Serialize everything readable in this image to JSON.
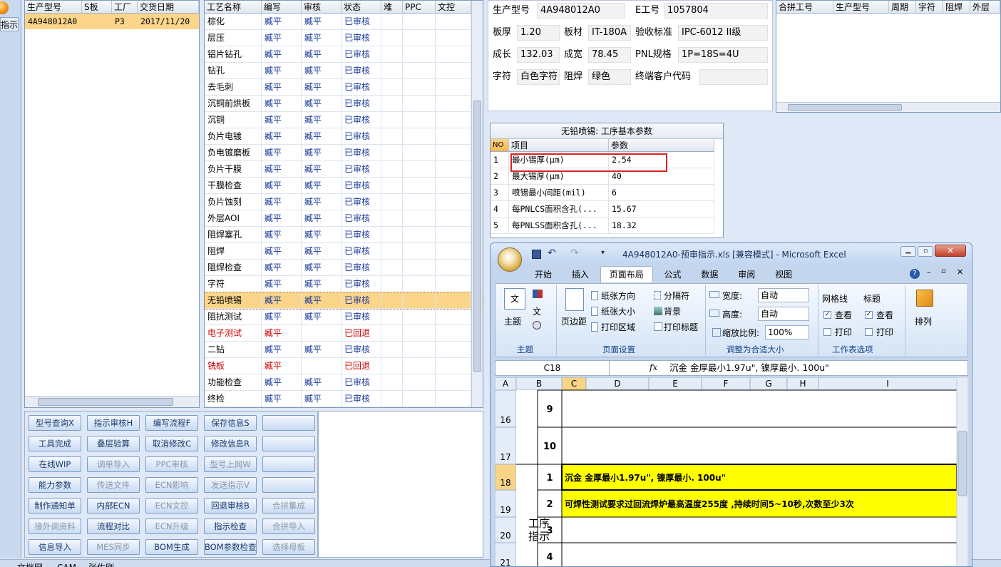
{
  "left_tab": {
    "label": "指示"
  },
  "orders": {
    "columns": [
      "生产型号",
      "S板",
      "工厂",
      "交货日期"
    ],
    "rows": [
      [
        "4A948012A0",
        "",
        "P3",
        "2017/11/20"
      ]
    ]
  },
  "process": {
    "columns": [
      "工艺名称",
      "编写",
      "审核",
      "状态",
      "难",
      "PPC",
      "文控"
    ],
    "rows": [
      {
        "name": "棕化",
        "writer": "臧平",
        "reviewer": "臧平",
        "status": "已审核"
      },
      {
        "name": "层压",
        "writer": "臧平",
        "reviewer": "臧平",
        "status": "已审核"
      },
      {
        "name": "铝片钻孔",
        "writer": "臧平",
        "reviewer": "臧平",
        "status": "已审核"
      },
      {
        "name": "钻孔",
        "writer": "臧平",
        "reviewer": "臧平",
        "status": "已审核"
      },
      {
        "name": "去毛刺",
        "writer": "臧平",
        "reviewer": "臧平",
        "status": "已审核"
      },
      {
        "name": "沉铜前烘板",
        "writer": "臧平",
        "reviewer": "臧平",
        "status": "已审核"
      },
      {
        "name": "沉铜",
        "writer": "臧平",
        "reviewer": "臧平",
        "status": "已审核"
      },
      {
        "name": "负片电镀",
        "writer": "臧平",
        "reviewer": "臧平",
        "status": "已审核"
      },
      {
        "name": "负电镀磨板",
        "writer": "臧平",
        "reviewer": "臧平",
        "status": "已审核"
      },
      {
        "name": "负片干膜",
        "writer": "臧平",
        "reviewer": "臧平",
        "status": "已审核"
      },
      {
        "name": "干膜检查",
        "writer": "臧平",
        "reviewer": "臧平",
        "status": "已审核"
      },
      {
        "name": "负片蚀刻",
        "writer": "臧平",
        "reviewer": "臧平",
        "status": "已审核"
      },
      {
        "name": "外层AOI",
        "writer": "臧平",
        "reviewer": "臧平",
        "status": "已审核"
      },
      {
        "name": "阻焊塞孔",
        "writer": "臧平",
        "reviewer": "臧平",
        "status": "已审核"
      },
      {
        "name": "阻焊",
        "writer": "臧平",
        "reviewer": "臧平",
        "status": "已审核"
      },
      {
        "name": "阻焊检查",
        "writer": "臧平",
        "reviewer": "臧平",
        "status": "已审核"
      },
      {
        "name": "字符",
        "writer": "臧平",
        "reviewer": "臧平",
        "status": "已审核"
      },
      {
        "name": "无铅喷锡",
        "writer": "臧平",
        "reviewer": "臧平",
        "status": "已审核",
        "selected": true
      },
      {
        "name": "阻抗测试",
        "writer": "臧平",
        "reviewer": "臧平",
        "status": "已审核"
      },
      {
        "name": "电子测试",
        "writer": "臧平",
        "reviewer": "",
        "status": "已回退",
        "red": true
      },
      {
        "name": "二钻",
        "writer": "臧平",
        "reviewer": "臧平",
        "status": "已审核"
      },
      {
        "name": "铣板",
        "writer": "臧平",
        "reviewer": "",
        "status": "已回退",
        "red": true
      },
      {
        "name": "功能检查",
        "writer": "臧平",
        "reviewer": "臧平",
        "status": "已审核"
      },
      {
        "name": "终检",
        "writer": "臧平",
        "reviewer": "臧平",
        "status": "已审核"
      }
    ]
  },
  "info": {
    "labels": {
      "model": "生产型号",
      "eno": "E工号",
      "thick": "板厚",
      "material": "板材",
      "standard": "验收标准",
      "len": "成长",
      "width": "成宽",
      "pnl": "PNL规格",
      "char": "字符",
      "mask": "阻焊",
      "client": "终端客户代码"
    },
    "values": {
      "model": "4A948012A0",
      "eno": "1057804",
      "thick": "1.20",
      "material": "IT-180A",
      "standard": "IPC-6012 II级",
      "len": "132.03",
      "width": "78.45",
      "pnl": "1P=18S=4U",
      "char": "白色字符",
      "mask": "绿色",
      "client": ""
    }
  },
  "merge": {
    "columns": [
      "合拼工号",
      "生产型号",
      "周期",
      "字符",
      "阻焊",
      "外层"
    ]
  },
  "params": {
    "title": "无铅喷锡: 工序基本参数",
    "columns": [
      "NO",
      "项目",
      "参数"
    ],
    "rows": [
      [
        "1",
        "最小锡厚(μm)",
        "2.54"
      ],
      [
        "2",
        "最大锡厚(μm)",
        "40"
      ],
      [
        "3",
        "喷锡最小间距(mil)",
        "6"
      ],
      [
        "4",
        "每PNLCS面积含孔(...",
        "15.67"
      ],
      [
        "5",
        "每PNLSS面积含孔(...",
        "18.32"
      ]
    ]
  },
  "buttons": [
    [
      "型号查询X",
      "指示审核H",
      "编写流程F",
      "保存信息S",
      ""
    ],
    [
      "工具完成",
      "叠层验算",
      "取消修改C",
      "修改信息R",
      ""
    ],
    [
      "在线WIP",
      "调单导入",
      "PPC审核",
      "型号上网W",
      ""
    ],
    [
      "能力参数",
      "传送文件",
      "ECN影响",
      "发送指示V",
      ""
    ],
    [
      "制作通知单",
      "内部ECN",
      "ECN文控",
      "回退审核B",
      "合拼集成"
    ],
    [
      "接外调资料",
      "流程对比",
      "ECN升级",
      "指示检查",
      "合拼导入"
    ],
    [
      "信息导入",
      "MES同步",
      "BOM生成",
      "BOM参数检查",
      "选择母板"
    ]
  ],
  "bottom_tabs": [
    "文档网",
    "CAM",
    "张佐刚"
  ],
  "excel": {
    "title": "4A948012A0-预审指示.xls [兼容模式] - Microsoft Excel",
    "tabs": [
      "开始",
      "插入",
      "页面布局",
      "公式",
      "数据",
      "审阅",
      "视图"
    ],
    "ribbon": {
      "theme": "主题",
      "margin": "页边距",
      "orientation": "纸张方向",
      "size": "纸张大小",
      "area": "打印区域",
      "breaks": "分隔符",
      "background": "背景",
      "titles": "打印标题",
      "width_label": "宽度:",
      "width_value": "自动",
      "height_label": "高度:",
      "height_value": "自动",
      "scale_label": "缩放比例:",
      "scale_value": "100%",
      "gridlines": "网格线",
      "headings": "标题",
      "view": "查看",
      "print": "打印",
      "arrange": "排列",
      "group_theme": "主题",
      "group_page": "页面设置",
      "group_fit": "调整为合适大小",
      "group_sheet": "工作表选项"
    },
    "name_box": "C18",
    "formula": "沉金 金厚最小1.97u\", 镍厚最小. 100u\"",
    "columns": [
      "A",
      "B",
      "C",
      "D",
      "E",
      "F",
      "G",
      "H",
      "I"
    ],
    "rows": [
      {
        "num": "16",
        "b": "9",
        "c": ""
      },
      {
        "num": "17",
        "b": "10",
        "c": ""
      },
      {
        "num": "18",
        "b": "1",
        "c": "沉金 金厚最小1.97u\", 镍厚最小. 100u\""
      },
      {
        "num": "19",
        "b": "2",
        "c": "可焊性测试要求过回流焊炉最高温度255度 ,持续时间5~10秒,次数至少3次"
      },
      {
        "num": "20",
        "b": "3",
        "c": ""
      },
      {
        "num": "21",
        "b": "4",
        "c": ""
      }
    ],
    "merged_a": "工序\n指示"
  },
  "colors": {
    "highlight": "#ffff00",
    "selection": "#fbd58a",
    "red_box": "#e02020"
  }
}
